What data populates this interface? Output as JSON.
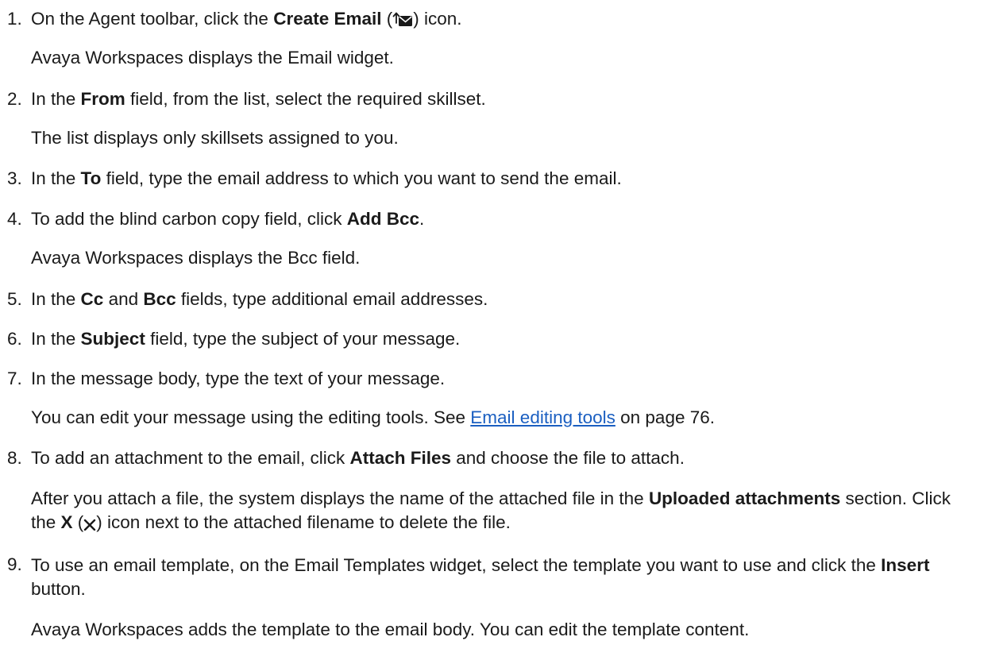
{
  "steps": [
    {
      "number": "1.",
      "lead": "On the Agent toolbar, click the ",
      "bold": "Create Email",
      "paren_open": " (",
      "paren_close": ") icon.",
      "icon": "create-email-icon",
      "result": "Avaya Workspaces displays the Email widget."
    },
    {
      "number": "2.",
      "lead": "In the ",
      "bold": "From",
      "tail": " field, from the list, select the required skillset.",
      "result": "The list displays only skillsets assigned to you."
    },
    {
      "number": "3.",
      "lead": "In the ",
      "bold": "To",
      "tail": " field, type the email address to which you want to send the email."
    },
    {
      "number": "4.",
      "lead": "To add the blind carbon copy field, click ",
      "bold": "Add Bcc",
      "tail": ".",
      "result": "Avaya Workspaces displays the Bcc field."
    },
    {
      "number": "5.",
      "lead": "In the ",
      "bold1": "Cc",
      "mid": " and ",
      "bold2": "Bcc",
      "tail": " fields, type additional email addresses."
    },
    {
      "number": "6.",
      "lead": "In the ",
      "bold": "Subject",
      "tail": " field, type the subject of your message."
    },
    {
      "number": "7.",
      "text": "In the message body, type the text of your message.",
      "result_lead": "You can edit your message using the editing tools. See ",
      "link": "Email editing tools",
      "result_tail": " on page 76."
    },
    {
      "number": "8.",
      "lead": "To add an attachment to the email, click ",
      "bold": "Attach Files",
      "tail": " and choose the file to attach.",
      "result_lead": "After you attach a file, the system displays the name of the attached file in the ",
      "result_bold": "Uploaded attachments",
      "result_mid": " section. Click the ",
      "result_bold2": "X",
      "result_paren_open": " (",
      "result_icon": "close-x-icon",
      "result_tail": ") icon next to the attached filename to delete the file."
    },
    {
      "number": "9.",
      "lead": "To use an email template, on the Email Templates widget, select the template you want to use and click the ",
      "bold": "Insert",
      "tail": " button.",
      "result": "Avaya Workspaces adds the template to the email body. You can edit the template content."
    }
  ],
  "colors": {
    "text": "#1a1a1a",
    "link": "#1b5fc1"
  }
}
